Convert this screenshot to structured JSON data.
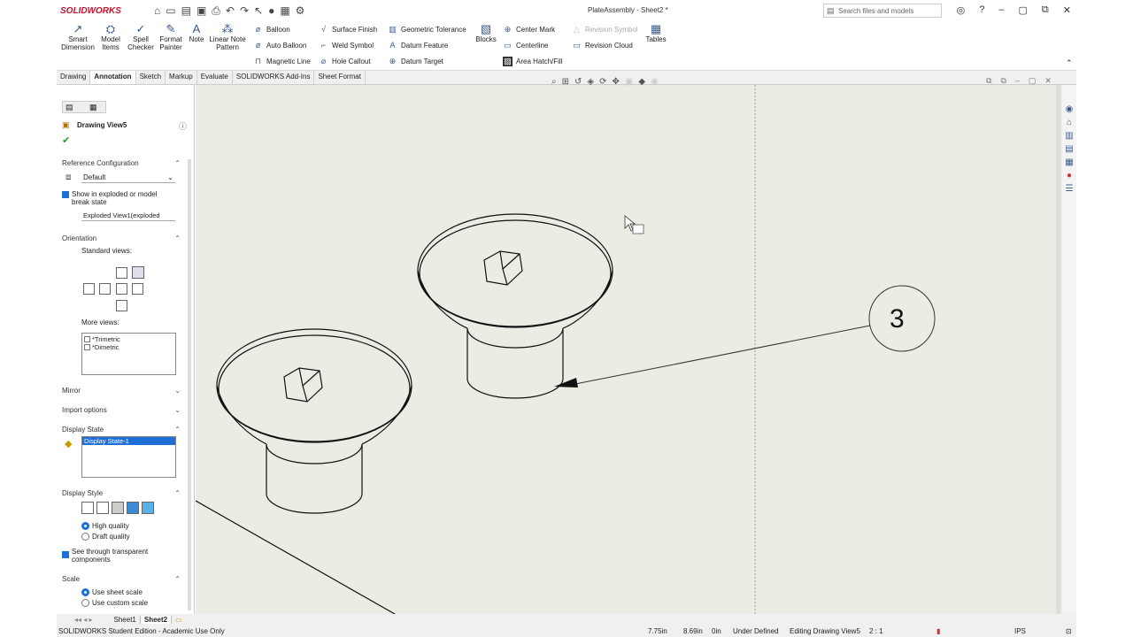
{
  "app": {
    "brand": "SOLIDWORKS",
    "doc_title": "PlateAssembly - Sheet2 *",
    "search_placeholder": "Search files and models"
  },
  "ribbon": {
    "big": [
      {
        "label": "Smart Dimension",
        "icon": "smart-dimension-icon"
      },
      {
        "label": "Model Items",
        "icon": "model-items-icon"
      },
      {
        "label": "Spell Checker",
        "icon": "spell-checker-icon"
      },
      {
        "label": "Format Painter",
        "icon": "format-painter-icon"
      },
      {
        "label": "Note",
        "icon": "note-icon"
      },
      {
        "label": "Linear Note Pattern",
        "icon": "linear-note-pattern-icon"
      }
    ],
    "col1": [
      "Balloon",
      "Auto Balloon",
      "Magnetic Line"
    ],
    "col2": [
      "Surface Finish",
      "Weld Symbol",
      "Hole Callout"
    ],
    "col3": [
      "Geometric Tolerance",
      "Datum Feature",
      "Datum Target"
    ],
    "blocks": "Blocks",
    "col4": [
      "Center Mark",
      "Centerline",
      "Area Hatch/Fill"
    ],
    "col5": [
      "Revision Symbol",
      "Revision Cloud"
    ],
    "tables": "Tables"
  },
  "tabs": [
    "Drawing",
    "Annotation",
    "Sketch",
    "Markup",
    "Evaluate",
    "SOLIDWORKS Add-Ins",
    "Sheet Format"
  ],
  "active_tab": "Annotation",
  "panel": {
    "title": "Drawing View5",
    "ref_config": {
      "header": "Reference Configuration",
      "value": "Default",
      "checkbox": "Show in exploded or model break state",
      "exploded": "Exploded View1(exploded"
    },
    "orientation": {
      "header": "Orientation",
      "std": "Standard views:",
      "more": "More views:",
      "items": [
        "*Trimetric",
        "*Dimetric"
      ]
    },
    "mirror": "Mirror",
    "import": "Import options",
    "display_state": {
      "header": "Display State",
      "item": "Display State-1"
    },
    "display_style": {
      "header": "Display Style",
      "radio1": "High quality",
      "radio2": "Draft quality",
      "check": "See through transparent components"
    },
    "scale": {
      "header": "Scale",
      "radio1": "Use sheet scale",
      "radio2": "Use custom scale"
    }
  },
  "balloon_number": "3",
  "sheets": [
    "Sheet1",
    "Sheet2"
  ],
  "active_sheet": "Sheet2",
  "status": {
    "edition": "SOLIDWORKS Student Edition - Academic Use Only",
    "x": "7.75in",
    "y": "8.69in",
    "z": "0in",
    "def": "Under Defined",
    "editing": "Editing Drawing View5",
    "scale": "2 : 1",
    "units": "IPS"
  }
}
